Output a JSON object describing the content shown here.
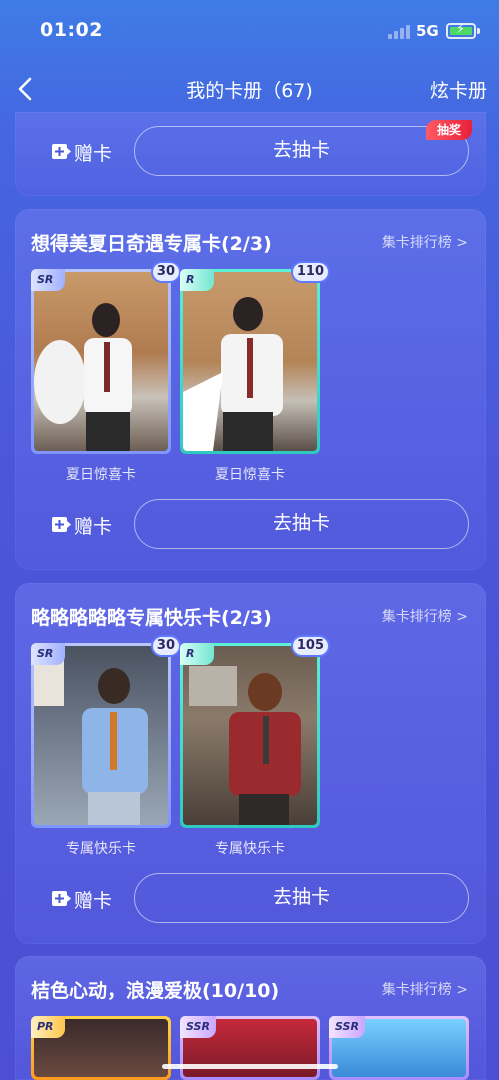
{
  "status": {
    "time": "01:02",
    "network": "5G"
  },
  "header": {
    "title": "我的卡册（67)",
    "action": "炫卡册"
  },
  "top_panel": {
    "gift_label": "赠卡",
    "draw_label": "去抽卡",
    "tag": "抽奖"
  },
  "sections": [
    {
      "title": "想得美夏日奇遇专属卡(2/3)",
      "rank_link": "集卡排行榜 >",
      "gift_label": "赠卡",
      "draw_label": "去抽卡",
      "cards": [
        {
          "rarity": "SR",
          "count": "30",
          "label": "夏日惊喜卡"
        },
        {
          "rarity": "R",
          "count": "110",
          "label": "夏日惊喜卡"
        }
      ]
    },
    {
      "title": "略略略略略专属快乐卡(2/3)",
      "rank_link": "集卡排行榜 >",
      "gift_label": "赠卡",
      "draw_label": "去抽卡",
      "cards": [
        {
          "rarity": "SR",
          "count": "30",
          "label": "专属快乐卡"
        },
        {
          "rarity": "R",
          "count": "105",
          "label": "专属快乐卡"
        }
      ]
    },
    {
      "title": "桔色心动，浪漫爱极(10/10)",
      "rank_link": "集卡排行榜 >",
      "cards": [
        {
          "rarity": "PR"
        },
        {
          "rarity": "SSR"
        },
        {
          "rarity": "SSR"
        }
      ]
    }
  ],
  "colors": {
    "sr_frame": "#8fa8ff",
    "r_frame": "#3ee0c8",
    "pr_frame": "#ffb82e",
    "ssr_frame": "#c9a6ff",
    "lottery_tag": "#ee2a44"
  }
}
